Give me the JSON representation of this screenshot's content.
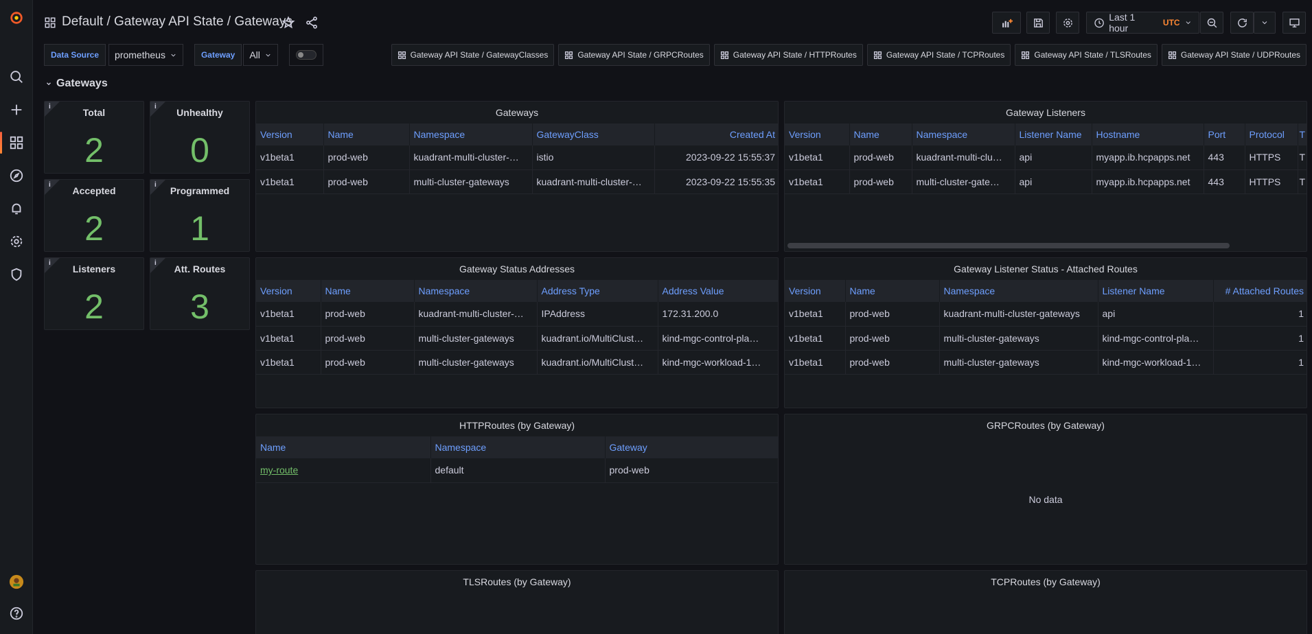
{
  "header": {
    "breadcrumb": [
      "Default",
      "/ Gateway API State / Gateways"
    ],
    "time_range": "Last 1 hour",
    "timezone": "UTC"
  },
  "variables": {
    "datasource_label": "Data Source",
    "datasource_value": "prometheus",
    "gateway_label": "Gateway",
    "gateway_value": "All"
  },
  "dashboard_links": [
    "Gateway API State / GatewayClasses",
    "Gateway API State / GRPCRoutes",
    "Gateway API State / HTTPRoutes",
    "Gateway API State / TCPRoutes",
    "Gateway API State / TLSRoutes",
    "Gateway API State / UDPRoutes"
  ],
  "row_title": "Gateways",
  "stats": {
    "total": {
      "title": "Total",
      "value": "2",
      "info": "i"
    },
    "unhealthy": {
      "title": "Unhealthy",
      "value": "0",
      "info": "i"
    },
    "accepted": {
      "title": "Accepted",
      "value": "2",
      "info": "i"
    },
    "programmed": {
      "title": "Programmed",
      "value": "1",
      "info": "i"
    },
    "listeners": {
      "title": "Listeners",
      "value": "2",
      "info": "i"
    },
    "att_routes": {
      "title": "Att. Routes",
      "value": "3",
      "info": "i"
    }
  },
  "gateways": {
    "title": "Gateways",
    "headers": [
      "Version",
      "Name",
      "Namespace",
      "GatewayClass",
      "Created At"
    ],
    "rows": [
      [
        "v1beta1",
        "prod-web",
        "kuadrant-multi-cluster-…",
        "istio",
        "2023-09-22 15:55:37"
      ],
      [
        "v1beta1",
        "prod-web",
        "multi-cluster-gateways",
        "kuadrant-multi-cluster-…",
        "2023-09-22 15:55:35"
      ]
    ]
  },
  "gateway_listeners": {
    "title": "Gateway Listeners",
    "headers": [
      "Version",
      "Name",
      "Namespace",
      "Listener Name",
      "Hostname",
      "Port",
      "Protocol",
      "T"
    ],
    "rows": [
      [
        "v1beta1",
        "prod-web",
        "kuadrant-multi-clu…",
        "api",
        "myapp.ib.hcpapps.net",
        "443",
        "HTTPS",
        "T"
      ],
      [
        "v1beta1",
        "prod-web",
        "multi-cluster-gate…",
        "api",
        "myapp.ib.hcpapps.net",
        "443",
        "HTTPS",
        "T"
      ]
    ]
  },
  "status_addresses": {
    "title": "Gateway Status Addresses",
    "headers": [
      "Version",
      "Name",
      "Namespace",
      "Address Type",
      "Address Value"
    ],
    "rows": [
      [
        "v1beta1",
        "prod-web",
        "kuadrant-multi-cluster-…",
        "IPAddress",
        "172.31.200.0"
      ],
      [
        "v1beta1",
        "prod-web",
        "multi-cluster-gateways",
        "kuadrant.io/MultiClust…",
        "kind-mgc-control-pla…"
      ],
      [
        "v1beta1",
        "prod-web",
        "multi-cluster-gateways",
        "kuadrant.io/MultiClust…",
        "kind-mgc-workload-1…"
      ]
    ]
  },
  "listener_status": {
    "title": "Gateway Listener Status - Attached Routes",
    "headers": [
      "Version",
      "Name",
      "Namespace",
      "Listener Name",
      "# Attached Routes"
    ],
    "rows": [
      [
        "v1beta1",
        "prod-web",
        "kuadrant-multi-cluster-gateways",
        "api",
        "1"
      ],
      [
        "v1beta1",
        "prod-web",
        "multi-cluster-gateways",
        "kind-mgc-control-pla…",
        "1"
      ],
      [
        "v1beta1",
        "prod-web",
        "multi-cluster-gateways",
        "kind-mgc-workload-1…",
        "1"
      ]
    ]
  },
  "httproutes": {
    "title": "HTTPRoutes (by Gateway)",
    "headers": [
      "Name",
      "Namespace",
      "Gateway"
    ],
    "rows": [
      [
        "my-route",
        "default",
        "prod-web"
      ]
    ]
  },
  "grpcroutes": {
    "title": "GRPCRoutes (by Gateway)",
    "no_data": "No data"
  },
  "tlsroutes": {
    "title": "TLSRoutes (by Gateway)"
  },
  "tcproutes": {
    "title": "TCPRoutes (by Gateway)"
  }
}
